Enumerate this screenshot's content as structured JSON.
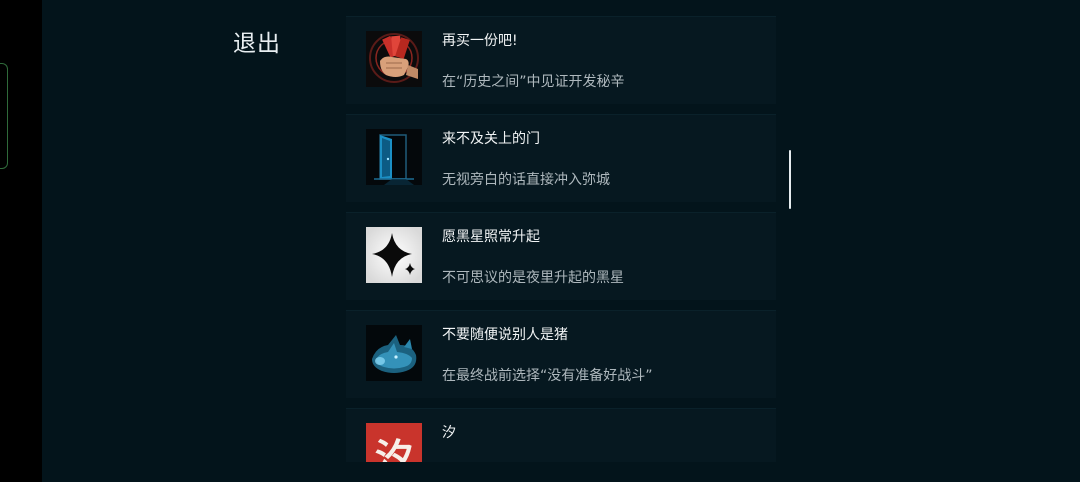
{
  "nav": {
    "exit_label": "退出"
  },
  "achievements": [
    {
      "title": "再买一份吧!",
      "description": "在“历史之间”中见证开发秘辛",
      "icon": "hand-holding-money-icon"
    },
    {
      "title": "来不及关上的门",
      "description": "无视旁白的话直接冲入弥城",
      "icon": "open-door-icon"
    },
    {
      "title": "愿黑星照常升起",
      "description": "不可思议的是夜里升起的黑星",
      "icon": "black-star-icon"
    },
    {
      "title": "不要随便说别人是猪",
      "description": "在最终战前选择“没有准备好战斗”",
      "icon": "pig-head-icon"
    },
    {
      "title": "汐",
      "description": "",
      "icon": "xi-character-icon",
      "icon_text": "汐"
    }
  ],
  "colors": {
    "background": "#03141b",
    "card": "#061820",
    "text": "#f1f4f5",
    "subtext": "#aeb8bd"
  }
}
